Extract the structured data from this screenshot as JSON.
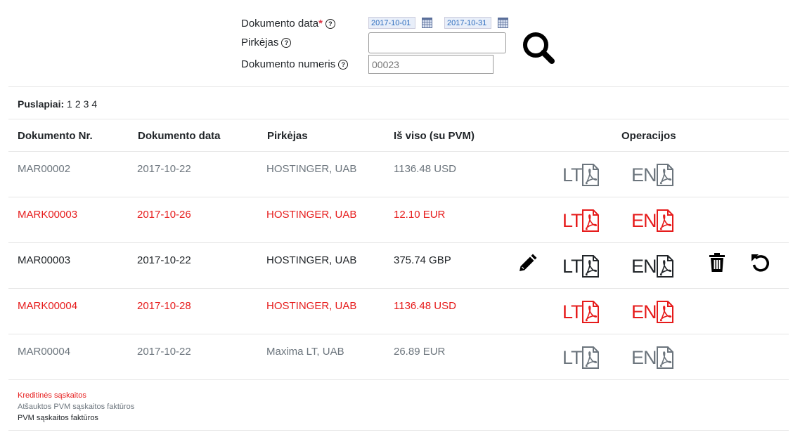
{
  "filters": {
    "date_label": "Dokumento data",
    "required_mark": "*",
    "date_from": "2017-10-01",
    "date_to": "2017-10-31",
    "buyer_label": "Pirkėjas",
    "buyer_value": "",
    "doc_number_label": "Dokumento numeris",
    "doc_number_value": "00023",
    "help_glyph": "?"
  },
  "pagination": {
    "label": "Puslapiai:",
    "pages": [
      "1",
      "2",
      "3",
      "4"
    ]
  },
  "table": {
    "headers": {
      "doc_nr": "Dokumento Nr.",
      "doc_date": "Dokumento data",
      "buyer": "Pirkėjas",
      "total": "Iš viso (su PVM)",
      "operations": "Operacijos"
    },
    "rows": [
      {
        "doc_nr": "MAR00002",
        "date": "2017-10-22",
        "buyer": "HOSTINGER, UAB",
        "total": "1136.48 USD",
        "type": "cancelled",
        "color": "#6c757d",
        "lt": "LT",
        "en": "EN",
        "editable": false
      },
      {
        "doc_nr": "MARK00003",
        "date": "2017-10-26",
        "buyer": "HOSTINGER, UAB",
        "total": "12.10 EUR",
        "type": "credit",
        "color": "#e61b1b",
        "lt": "LT",
        "en": "EN",
        "editable": false
      },
      {
        "doc_nr": "MAR00003",
        "date": "2017-10-22",
        "buyer": "HOSTINGER, UAB",
        "total": "375.74 GBP",
        "type": "invoice",
        "color": "#000000",
        "lt": "LT",
        "en": "EN",
        "editable": true
      },
      {
        "doc_nr": "MARK00004",
        "date": "2017-10-28",
        "buyer": "HOSTINGER, UAB",
        "total": "1136.48 USD",
        "type": "credit",
        "color": "#e61b1b",
        "lt": "LT",
        "en": "EN",
        "editable": false
      },
      {
        "doc_nr": "MAR00004",
        "date": "2017-10-22",
        "buyer": "Maxima LT, UAB",
        "total": "26.89 EUR",
        "type": "cancelled",
        "color": "#6c757d",
        "lt": "LT",
        "en": "EN",
        "editable": false
      }
    ]
  },
  "legend": {
    "credit": "Kreditinės sąskaitos",
    "cancelled": "Atšauktos PVM sąskaitos faktūros",
    "invoice": "PVM sąskaitos faktūros"
  },
  "icons": {
    "help": "question-circle-icon",
    "calendar": "calendar-icon",
    "search": "search-icon",
    "pdf": "pdf-file-icon",
    "edit": "pencil-icon",
    "delete": "trash-icon",
    "revert": "undo-icon"
  },
  "colors": {
    "credit": "#e61b1b",
    "cancelled": "#6c757d",
    "invoice": "#212529",
    "date_input_bg": "#e8eef9",
    "date_input_text": "#2a6bbd"
  }
}
